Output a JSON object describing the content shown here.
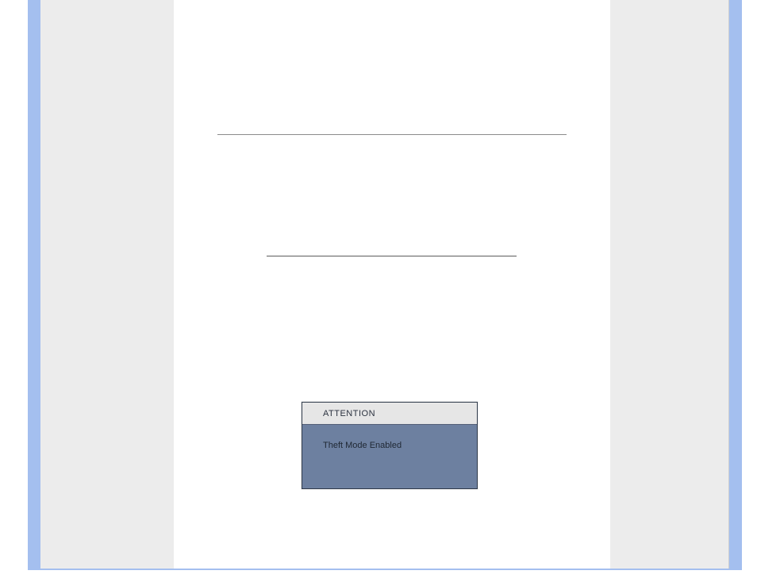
{
  "modal": {
    "title": "ATTENTION",
    "message": "Theft Mode Enabled"
  }
}
